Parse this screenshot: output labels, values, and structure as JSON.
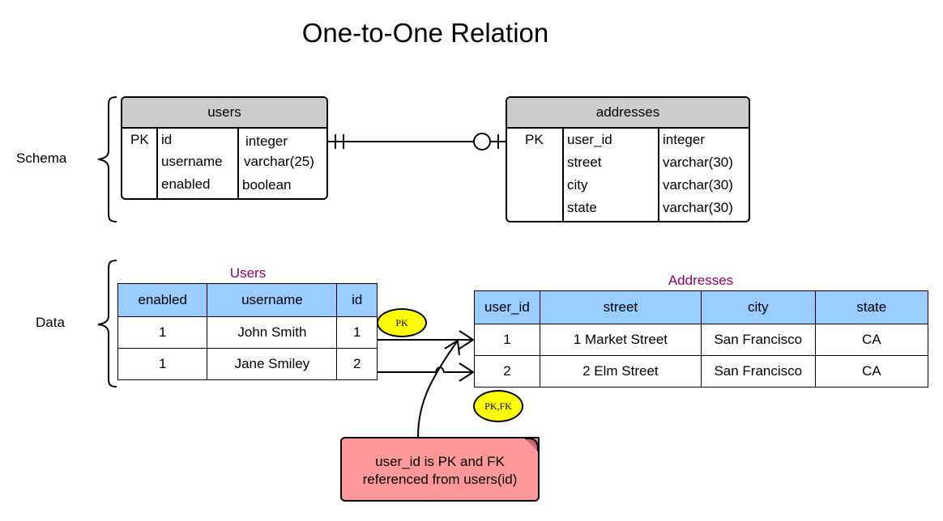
{
  "title": "One-to-One Relation",
  "sections": {
    "schema_label": "Schema",
    "data_label": "Data"
  },
  "schema": {
    "users": {
      "name": "users",
      "key_column": [
        "PK",
        "",
        ""
      ],
      "fields": [
        "id",
        "username",
        "enabled"
      ],
      "types": [
        "integer",
        "varchar(25)",
        "boolean"
      ]
    },
    "addresses": {
      "name": "addresses",
      "key_column": [
        "PK",
        "",
        "",
        ""
      ],
      "fields": [
        "user_id",
        "street",
        "city",
        "state"
      ],
      "types": [
        "integer",
        "varchar(30)",
        "varchar(30)",
        "varchar(30)"
      ]
    },
    "relationship": {
      "from": "users",
      "to": "addresses",
      "from_cardinality": "exactly-one",
      "to_cardinality": "zero-or-one"
    }
  },
  "data": {
    "users": {
      "caption": "Users",
      "columns": [
        "enabled",
        "username",
        "id"
      ],
      "rows": [
        [
          "1",
          "John Smith",
          "1"
        ],
        [
          "1",
          "Jane Smiley",
          "2"
        ]
      ],
      "badge": "PK"
    },
    "addresses": {
      "caption": "Addresses",
      "columns": [
        "user_id",
        "street",
        "city",
        "state"
      ],
      "rows": [
        [
          "1",
          "1 Market Street",
          "San Francisco",
          "CA"
        ],
        [
          "2",
          "2 Elm Street",
          "San Francisco",
          "CA"
        ]
      ],
      "badge": "PK,FK"
    }
  },
  "note": {
    "line1": "user_id is PK and FK",
    "line2": "referenced from users(id)"
  },
  "colors": {
    "entity_header": "#cccccc",
    "table_header": "#99ccff",
    "caption": "#990066",
    "badge": "#ffff00",
    "note": "#ff9999"
  }
}
